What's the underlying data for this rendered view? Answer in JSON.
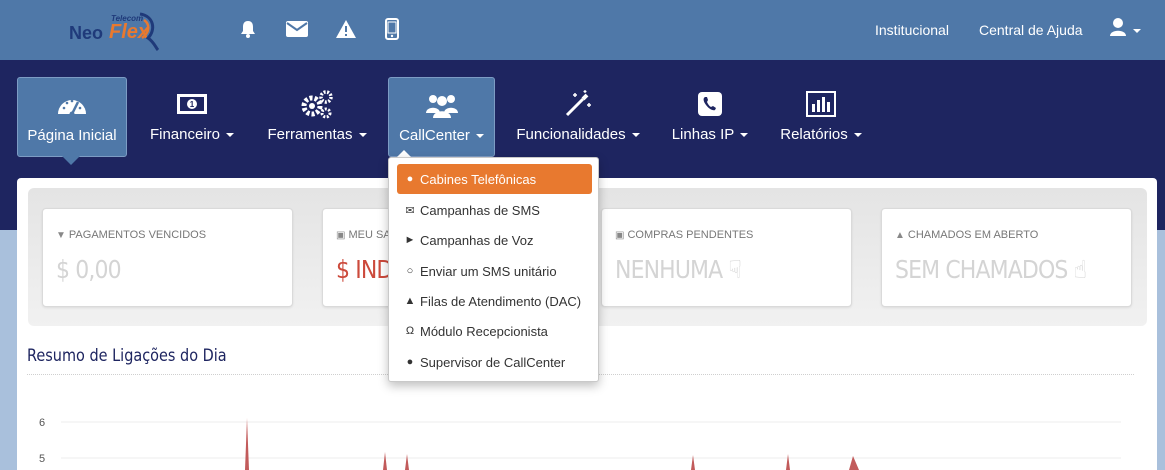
{
  "brand": {
    "name_part1": "Neo",
    "name_part2": "Flex",
    "tagline": "Telecom",
    "accent": "#e8792f",
    "primary": "#1e2560"
  },
  "topbar": {
    "icons": [
      "bell-icon",
      "envelope-icon",
      "warning-icon",
      "mobile-icon"
    ],
    "links": [
      {
        "label": "Institucional"
      },
      {
        "label": "Central de Ajuda"
      }
    ],
    "user_icon": "user-icon"
  },
  "nav": {
    "items": [
      {
        "label": "Página Inicial",
        "icon": "dashboard-gauge-icon",
        "active": true
      },
      {
        "label": "Financeiro",
        "icon": "money-icon"
      },
      {
        "label": "Ferramentas",
        "icon": "gears-icon"
      },
      {
        "label": "CallCenter",
        "icon": "users-icon",
        "open": true
      },
      {
        "label": "Funcionalidades",
        "icon": "magic-wand-icon"
      },
      {
        "label": "Linhas IP",
        "icon": "phone-icon"
      },
      {
        "label": "Relatórios",
        "icon": "bar-chart-icon"
      }
    ]
  },
  "callcenter_menu": {
    "items": [
      {
        "label": "Cabines Telefônicas",
        "icon": "globe-icon",
        "highlighted": true
      },
      {
        "label": "Campanhas de SMS",
        "icon": "envelope-icon"
      },
      {
        "label": "Campanhas de Voz",
        "icon": "bullhorn-icon"
      },
      {
        "label": "Enviar um SMS unitário",
        "icon": "comments-icon"
      },
      {
        "label": "Filas de Atendimento (DAC)",
        "icon": "sitemap-icon"
      },
      {
        "label": "Módulo Recepcionista",
        "icon": "headphones-icon"
      },
      {
        "label": "Supervisor de CallCenter",
        "icon": "users-icon"
      }
    ]
  },
  "stats": [
    {
      "title": "PAGAMENTOS VENCIDOS",
      "value": "$ 0,00",
      "icon": "thumbs-down-icon"
    },
    {
      "title": "MEU SA",
      "value": "$ INDI",
      "icon": "money-icon",
      "color": "#cc4a3c"
    },
    {
      "title": "COMPRAS PENDENTES",
      "value": "NENHUMA",
      "icon": "cart-icon",
      "value_icon": "thumbs-down-icon"
    },
    {
      "title": "CHAMADOS EM ABERTO",
      "value": "SEM CHAMADOS",
      "icon": "sitemap-icon",
      "value_icon": "thumbs-up-icon"
    }
  ],
  "summary": {
    "title": "Resumo de Ligações do Dia"
  },
  "chart_data": {
    "type": "area",
    "visible_y_ticks": [
      "6",
      "5"
    ],
    "series_color": "#c25b5b",
    "spikes_approx_x_index": [
      5,
      9,
      10,
      17,
      20,
      21
    ]
  }
}
